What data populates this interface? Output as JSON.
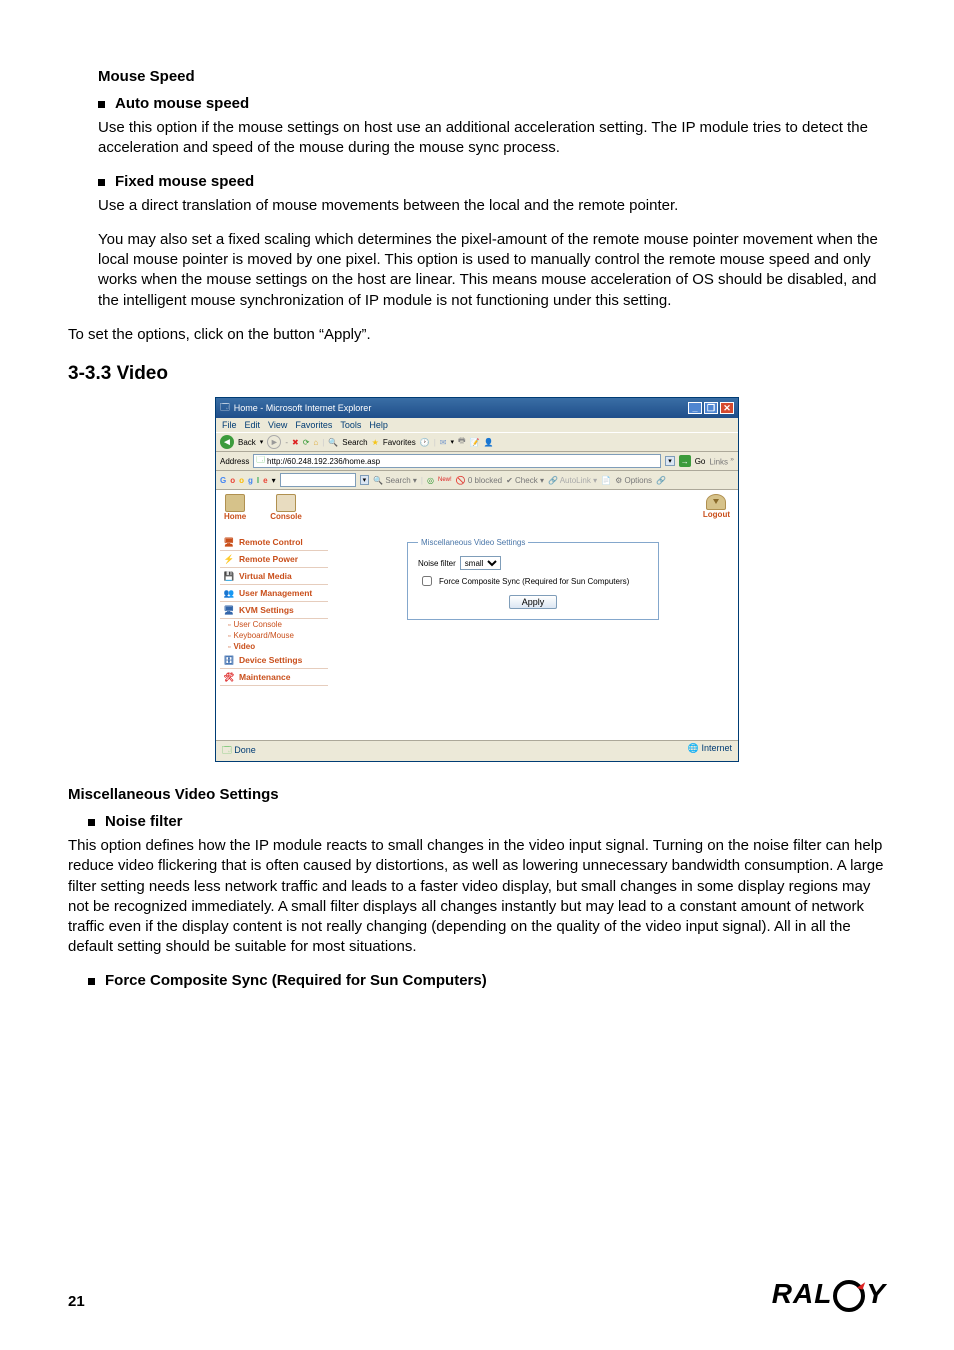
{
  "section": {
    "mouse_speed_heading": "Mouse Speed",
    "auto_heading": "Auto mouse speed",
    "auto_body": "Use this option if the mouse settings on host use an additional acceleration setting. The IP module tries to detect the acceleration and speed of the mouse during the mouse sync process.",
    "fixed_heading": "Fixed mouse speed",
    "fixed_body1": "Use a direct translation of mouse movements between the local and the remote pointer.",
    "fixed_body2": "You may also set a fixed scaling which determines the pixel-amount of the remote mouse pointer movement when the local mouse pointer is moved by one pixel. This option is used to manually control the remote mouse speed and only works when the mouse settings on the host are linear. This means mouse acceleration of OS should be disabled, and the intelligent mouse synchronization of IP module is not functioning under this setting.",
    "apply_note": "To set the options, click on the button “Apply”.",
    "video_heading": "3-3.3  Video",
    "misc_heading": "Miscellaneous Video Settings",
    "nf_heading": "Noise filter",
    "nf_body": "This option defines how the IP module reacts to small changes in the video input signal. Turning on the noise filter can help reduce video flickering that is often caused by distortions, as well as lowering unnecessary bandwidth consumption. A large filter setting needs less network traffic and leads to a faster video display, but small changes in some display regions may not be recognized immediately. A small filter displays all changes instantly but may lead to a constant amount of network traffic even if the display content is not really changing (depending on the quality of the video input signal). All in all the default setting should be suitable for most situations.",
    "force_heading": "Force Composite Sync (Required for Sun Computers)"
  },
  "ie": {
    "title": "Home - Microsoft Internet Explorer",
    "menu": {
      "file": "File",
      "edit": "Edit",
      "view": "View",
      "favorites": "Favorites",
      "tools": "Tools",
      "help": "Help"
    },
    "back": "Back",
    "search": "Search",
    "favorites_btn": "Favorites",
    "address_label": "Address",
    "address_value": "http://60.248.192.236/home.asp",
    "go": "Go",
    "links": "Links",
    "google_label": "Google",
    "g_search": "Search",
    "g_blocked": "0 blocked",
    "g_check": "Check",
    "g_autolink": "AutoLink",
    "g_options": "Options",
    "status_done": "Done",
    "status_zone": "Internet"
  },
  "app": {
    "top": {
      "home": "Home",
      "console": "Console",
      "logout": "Logout"
    },
    "side": {
      "remote_control": "Remote Control",
      "remote_power": "Remote Power",
      "virtual_media": "Virtual Media",
      "user_mgmt": "User Management",
      "kvm": "KVM Settings",
      "sub_user_console": "User Console",
      "sub_kb_mouse": "Keyboard/Mouse",
      "sub_video": "Video",
      "device": "Device Settings",
      "maint": "Maintenance"
    },
    "panel": {
      "legend": "Miscellaneous Video Settings",
      "noise_label": "Noise filter",
      "noise_value": "small",
      "force_label": "Force Composite Sync (Required for Sun Computers)",
      "apply": "Apply"
    }
  },
  "footer": {
    "page": "21",
    "logo": "RAL",
    "logo2": "Y"
  }
}
